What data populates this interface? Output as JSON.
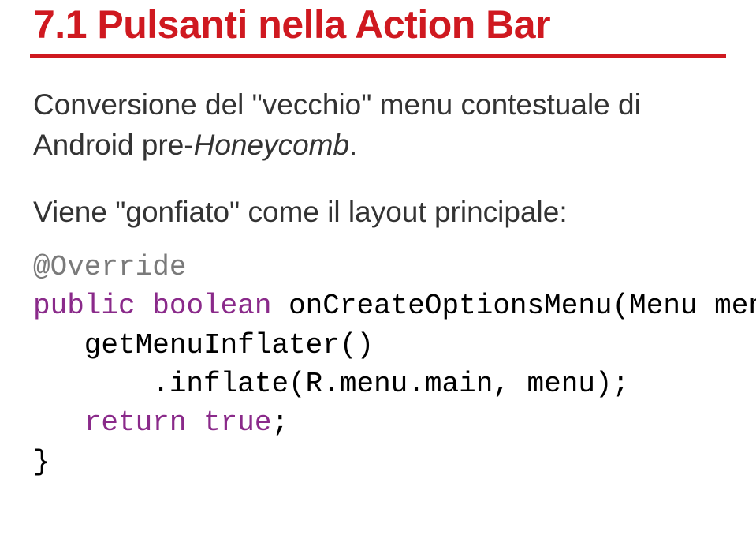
{
  "title": "7.1 Pulsanti nella Action Bar",
  "para1_pre": "Conversione del \"vecchio\" menu contestuale di Android pre-",
  "para1_italic": "Honeycomb",
  "para1_post": ".",
  "para2": "Viene \"gonfiato\" come il layout principale:",
  "code": {
    "annot": "@Override",
    "kw_public": "public",
    "kw_boolean": "boolean",
    "sig_rest": " onCreateOptionsMenu(Menu menu) {",
    "line3": "   getMenuInflater()",
    "line4": "       .inflate(R.menu.main, menu);",
    "indent_return": "   ",
    "kw_return": "return",
    "space_true": " ",
    "kw_true": "true",
    "after_true": ";",
    "line6": "}"
  }
}
